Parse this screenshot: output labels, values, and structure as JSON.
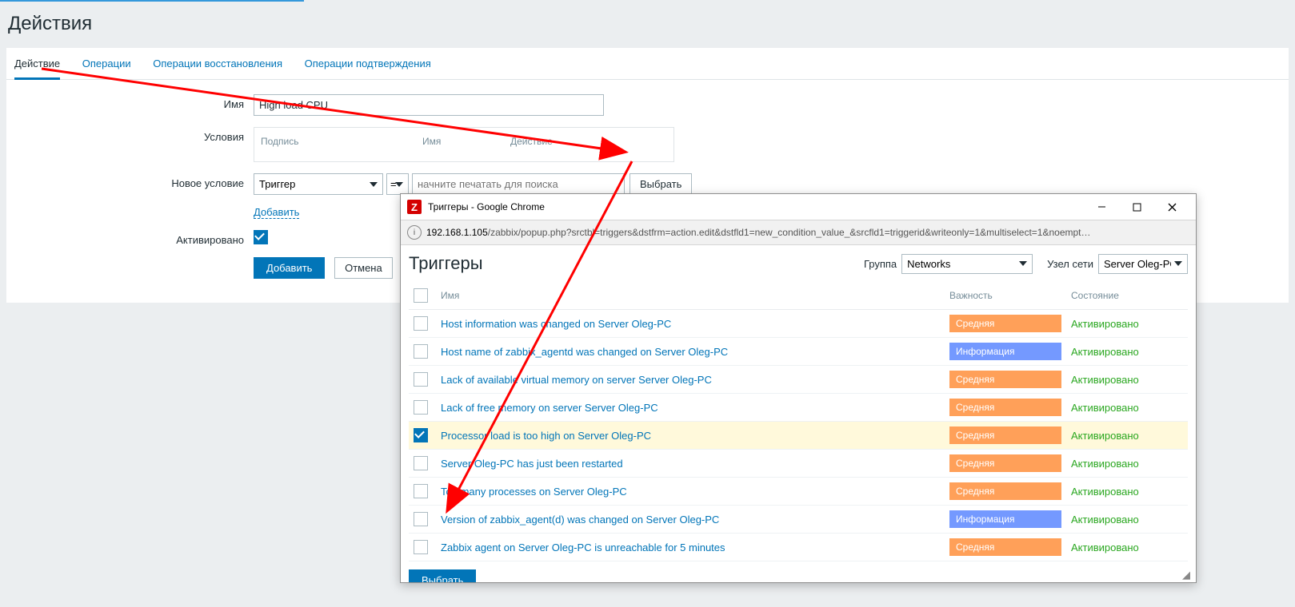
{
  "page_title": "Действия",
  "tabs": [
    "Действие",
    "Операции",
    "Операции восстановления",
    "Операции подтверждения"
  ],
  "form": {
    "name_label": "Имя",
    "name_value": "High load CPU",
    "conditions_label": "Условия",
    "cond_headers": [
      "Подпись",
      "Имя",
      "Действие"
    ],
    "newcond_label": "Новое условие",
    "trigger_select": "Триггер",
    "eq_select": "=",
    "cond_placeholder": "начните печатать для поиска",
    "select_btn": "Выбрать",
    "add_link": "Добавить",
    "enabled_label": "Активировано",
    "add_btn": "Добавить",
    "cancel_btn": "Отмена"
  },
  "popup": {
    "window_title": "Триггеры - Google Chrome",
    "url_host": "192.168.1.105",
    "url_path": "/zabbix/popup.php?srctbl=triggers&dstfrm=action.edit&dstfld1=new_condition_value_&srcfld1=triggerid&writeonly=1&multiselect=1&noempt…",
    "heading": "Триггеры",
    "group_label": "Группа",
    "group_value": "Networks",
    "host_label": "Узел сети",
    "host_value": "Server Oleg-PC",
    "th_name": "Имя",
    "th_sev": "Важность",
    "th_state": "Состояние",
    "rows": [
      {
        "name": "Host information was changed on Server Oleg-PC",
        "sev": "Средняя",
        "sev_class": "avg",
        "state": "Активировано",
        "checked": false
      },
      {
        "name": "Host name of zabbix_agentd was changed on Server Oleg-PC",
        "sev": "Информация",
        "sev_class": "info",
        "state": "Активировано",
        "checked": false
      },
      {
        "name": "Lack of available virtual memory on server Server Oleg-PC",
        "sev": "Средняя",
        "sev_class": "avg",
        "state": "Активировано",
        "checked": false
      },
      {
        "name": "Lack of free memory on server Server Oleg-PC",
        "sev": "Средняя",
        "sev_class": "avg",
        "state": "Активировано",
        "checked": false
      },
      {
        "name": "Processor load is too high on Server Oleg-PC",
        "sev": "Средняя",
        "sev_class": "avg",
        "state": "Активировано",
        "checked": true
      },
      {
        "name": "Server Oleg-PC has just been restarted",
        "sev": "Средняя",
        "sev_class": "avg",
        "state": "Активировано",
        "checked": false
      },
      {
        "name": "Too many processes on Server Oleg-PC",
        "sev": "Средняя",
        "sev_class": "avg",
        "state": "Активировано",
        "checked": false
      },
      {
        "name": "Version of zabbix_agent(d) was changed on Server Oleg-PC",
        "sev": "Информация",
        "sev_class": "info",
        "state": "Активировано",
        "checked": false
      },
      {
        "name": "Zabbix agent on Server Oleg-PC is unreachable for 5 minutes",
        "sev": "Средняя",
        "sev_class": "avg",
        "state": "Активировано",
        "checked": false
      }
    ],
    "select_btn": "Выбрать"
  }
}
